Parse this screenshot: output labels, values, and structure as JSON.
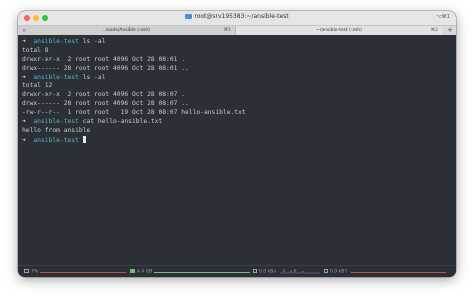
{
  "window": {
    "title": "root@srv195383:~/ansible-test",
    "shortcut": "⌥⌘1"
  },
  "tabs": [
    {
      "label": "..loads/Ansible (-zsh)",
      "shortcut": "⌘1",
      "close": "×"
    },
    {
      "label": "~/ansible-test (-zsh)",
      "shortcut": "⌘2"
    }
  ],
  "new_tab_label": "+",
  "terminal": {
    "lines": [
      {
        "prompt": "➜",
        "dir": "ansible-test",
        "cmd": " ls -al"
      },
      {
        "text": "total 8"
      },
      {
        "text": "drwxr-xr-x  2 root root 4096 Oct 28 08:01 ."
      },
      {
        "text": "drwx------ 28 root root 4096 Oct 28 08:01 .."
      },
      {
        "prompt": "➜",
        "dir": "ansible-test",
        "cmd": " ls -al"
      },
      {
        "text": "total 12"
      },
      {
        "text": "drwxr-xr-x  2 root root 4096 Oct 28 08:07 ."
      },
      {
        "text": "drwx------ 28 root root 4096 Oct 28 08:07 .."
      },
      {
        "text": "-rw-r--r--  1 root root   19 Oct 28 08:07 hello-ansible.txt"
      },
      {
        "prompt": "➜",
        "dir": "ansible-test",
        "cmd": " cat hello-ansible.txt"
      },
      {
        "text": "hello from ansible"
      },
      {
        "prompt": "➜",
        "dir": "ansible-test",
        "cmd": " ",
        "cursor": true
      }
    ]
  },
  "statusbar": {
    "cpu": "7%",
    "memory": "4.4 GB",
    "net_down": "0.0 kB↓",
    "net_up": "0.0 kB↑"
  },
  "colors": {
    "terminal_bg": "#2b2f36",
    "prompt_dir": "#56b6c2",
    "text": "#c8ccd1"
  }
}
